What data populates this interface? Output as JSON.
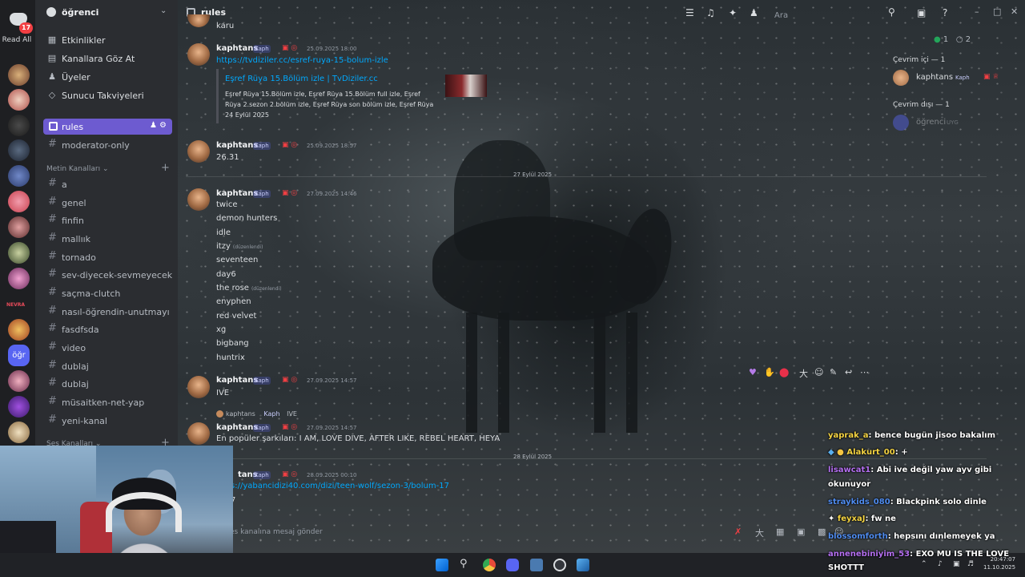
{
  "rail": {
    "read_all": "Read All",
    "badge": "17",
    "server_abbrev": "öğr",
    "separator_label": "NEVRA"
  },
  "server": {
    "name": "öğrenci"
  },
  "sidebar_menu": [
    {
      "icon": "calendar-icon",
      "label": "Etkinlikler"
    },
    {
      "icon": "browse-channels-icon",
      "label": "Kanallara Göz At"
    },
    {
      "icon": "members-icon",
      "label": "Üyeler"
    },
    {
      "icon": "boost-icon",
      "label": "Sunucu Takviyeleri"
    }
  ],
  "active_channel": "rules",
  "channels_top": [
    "moderator-only"
  ],
  "text_category": "Metin Kanalları",
  "channels": [
    "a",
    "genel",
    "finfin",
    "mallıık",
    "tornado",
    "sev-diyecek-sevmeyecek",
    "saçma-clutch",
    "nasıl-öğrendin-unutmayı",
    "fasdfsda",
    "video",
    "dublaj",
    "dublaj",
    "müsaitken-net-yap",
    "yeni-kanal"
  ],
  "voice_category": "Ses Kanalları",
  "topbar": {
    "title": "rules",
    "search_placeholder": "Ara"
  },
  "messages": {
    "top_fragment": "karu",
    "author": "kaphtans",
    "tag": "Kaph",
    "m1": {
      "time": "25.09.2025 18:00",
      "link": "https://tvdiziler.cc/esref-ruya-15-bolum-izle",
      "embed_title": "Eşref Rüya 15.Bölüm izle | TvDiziler.cc",
      "embed_desc": "Eşref Rüya 15.Bölüm izle, Eşref Rüya 15.Bölüm full izle, Eşref Rüya 2.sezon 2.bölüm izle, Eşref Rüya son bölüm izle, Eşref Rüya 24 Eylül 2025"
    },
    "m2": {
      "time": "25.09.2025 18:57",
      "text": "26.31"
    },
    "divider1": "27 Eylül 2025",
    "m3": {
      "time": "27.09.2025 14:46",
      "lines": [
        "twice",
        "demon hunters",
        "idle",
        "itzy",
        "seventeen",
        "day6",
        "the rose",
        "enyphen",
        "red velvet",
        "xg",
        "bigbang",
        "huntrix"
      ],
      "edited": "(düzenlendi)"
    },
    "m4": {
      "time": "27.09.2025 14:57",
      "text": "IVE"
    },
    "reply": {
      "author": "kaphtans",
      "tag": "Kaph",
      "text": "IVE"
    },
    "m5": {
      "time": "27.09.2025 14:57",
      "text": "En popüler şarkıları: I AM, LOVE DIVE, AFTER LIKE, REBEL HEART, HEYA"
    },
    "divider2": "28 Eylül 2025",
    "m6": {
      "author_partial": "tans",
      "time": "28.09.2025 00:10",
      "link_partial": "s://yabancidizi40.com/dizi/teen-wolf/sezon-3/bolum-17",
      "text_partial": "7"
    }
  },
  "composer": {
    "placeholder": "es kanalına mesaj gönder"
  },
  "members": {
    "online_count_label": "1",
    "offline_count_label": "2",
    "online_header": "Çevrim içi — 1",
    "online": [
      {
        "name": "kaphtans",
        "tag": "Kaph"
      }
    ],
    "offline_header": "Çevrim dışı — 1",
    "offline": [
      {
        "name": "öğrenci",
        "tag": "UYG"
      }
    ]
  },
  "twitch_chat": [
    {
      "user": "yaprak_a",
      "color": "#f5d442",
      "text": ": bence bugün jisoo bakalım"
    },
    {
      "user": "Alakurt_00",
      "color": "#f5d442",
      "text": ": +"
    },
    {
      "user": "lisawcat1",
      "color": "#b46ff0",
      "text": ": Abi ive değil yaw ayv gibi"
    },
    {
      "user": "",
      "color": "#ffffff",
      "text": "okunuyor"
    },
    {
      "user": "straykids_080",
      "color": "#4f8cf0",
      "text": ": Blackpink solo dinle"
    },
    {
      "user": "feyxaJ",
      "color": "#f5d442",
      "text": ": fw ne"
    },
    {
      "user": "blossomforth",
      "color": "#4f8cf0",
      "text": ": hepsını dınlemeyek ya"
    },
    {
      "user": "annenebiniyim_53",
      "color": "#b46ff0",
      "text": ": EXO MU IS THE LOVE"
    },
    {
      "user": "",
      "color": "#ffffff",
      "text": "SHOTTT"
    }
  ],
  "clock": {
    "time": "20:47:07",
    "date": "11.10.2025"
  }
}
